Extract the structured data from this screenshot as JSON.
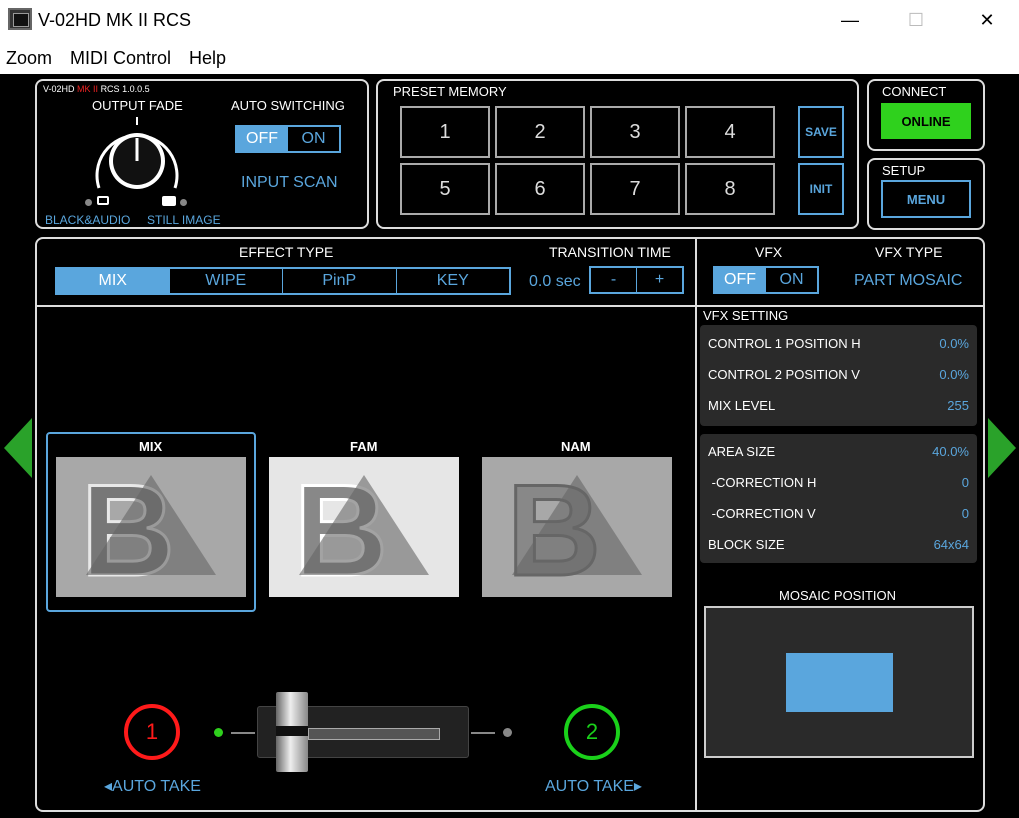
{
  "window": {
    "title": "V-02HD MK II RCS",
    "min": "—",
    "max": "☐",
    "close": "✕"
  },
  "menu": [
    "Zoom",
    "MIDI Control",
    "Help"
  ],
  "ctrl": {
    "model_a": "V-02HD",
    "model_b": "MK II",
    "model_c": "RCS 1.0.0.5",
    "output_fade": "OUTPUT FADE",
    "black_audio": "BLACK&AUDIO",
    "still_image": "STILL IMAGE",
    "auto_switching": "AUTO SWITCHING",
    "off": "OFF",
    "on": "ON",
    "input_scan": "INPUT SCAN"
  },
  "preset": {
    "title": "PRESET MEMORY",
    "buttons": [
      "1",
      "2",
      "3",
      "4",
      "5",
      "6",
      "7",
      "8"
    ],
    "save": "SAVE",
    "init": "INIT"
  },
  "connect": {
    "title": "CONNECT",
    "online": "ONLINE"
  },
  "setup": {
    "title": "SETUP",
    "menu": "MENU"
  },
  "effect": {
    "title": "EFFECT TYPE",
    "types": [
      "MIX",
      "WIPE",
      "PinP",
      "KEY"
    ],
    "transition_title": "TRANSITION TIME",
    "time": "0.0 sec",
    "minus": "-",
    "plus": "+"
  },
  "vfx": {
    "title": "VFX",
    "off": "OFF",
    "on": "ON",
    "type_title": "VFX TYPE",
    "type": "PART MOSAIC",
    "setting": "VFX SETTING",
    "rows1": [
      {
        "label": "CONTROL 1 POSITION H",
        "value": "0.0%"
      },
      {
        "label": "CONTROL 2 POSITION V",
        "value": "0.0%"
      },
      {
        "label": "MIX LEVEL",
        "value": "255"
      }
    ],
    "rows2": [
      {
        "label": "AREA SIZE",
        "value": "40.0%"
      },
      {
        "label": " -CORRECTION H",
        "value": "0"
      },
      {
        "label": " -CORRECTION V",
        "value": "0"
      },
      {
        "label": "BLOCK SIZE",
        "value": "64x64"
      }
    ],
    "mosaic_title": "MOSAIC POSITION"
  },
  "transitions": [
    {
      "label": "MIX"
    },
    {
      "label": "FAM"
    },
    {
      "label": "NAM"
    }
  ],
  "inputs": {
    "one": "1",
    "two": "2",
    "auto_take_left": "◂AUTO TAKE",
    "auto_take_right": "AUTO TAKE▸"
  },
  "colors": {
    "accent": "#5aa6dd",
    "online": "#2fd11d",
    "input1": "#ff1a1a",
    "input2": "#1ad11a"
  }
}
